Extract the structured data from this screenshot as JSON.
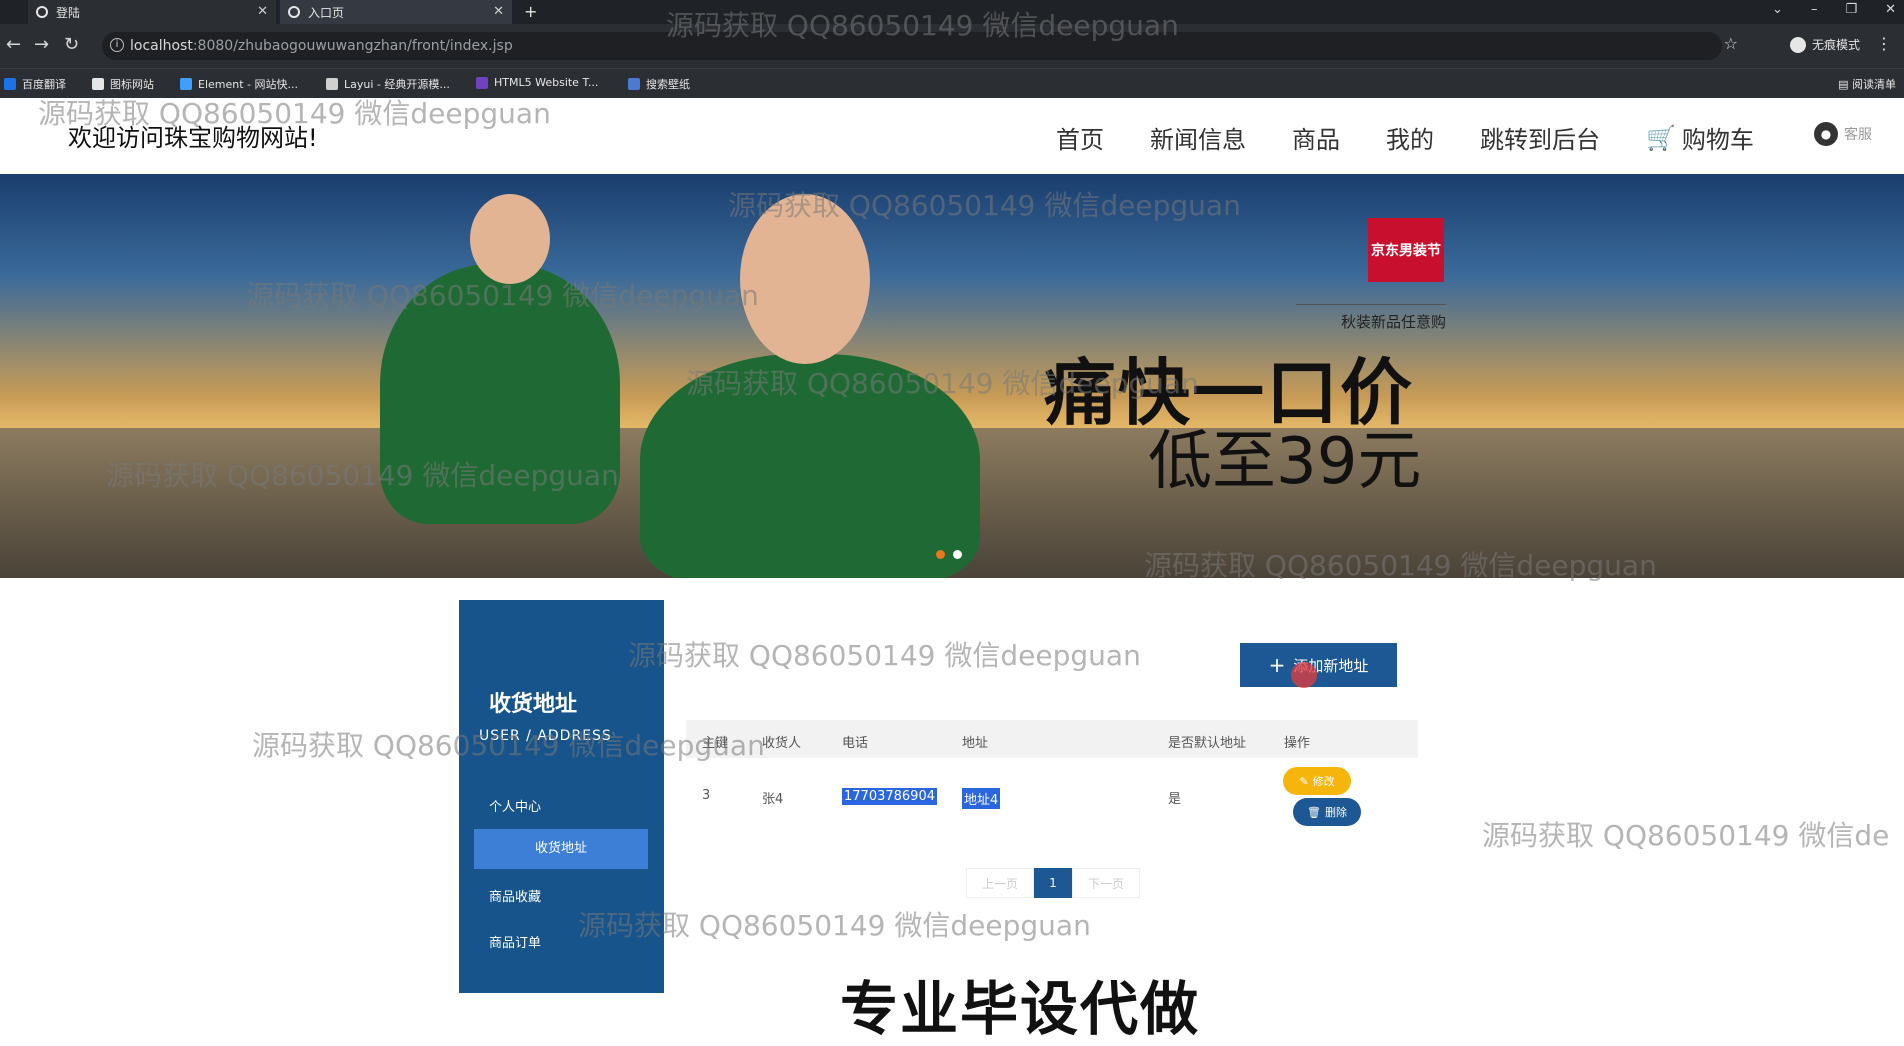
{
  "browser": {
    "tabs": [
      {
        "label": "登陆"
      },
      {
        "label": "入口页"
      }
    ],
    "address_host": "localhost",
    "address_path": ":8080/zhubaogouwuwangzhan/front/index.jsp",
    "incognito_label": "无痕模式",
    "bookmarks": [
      "百度翻译",
      "图标网站",
      "Element - 网站快...",
      "Layui - 经典开源模...",
      "HTML5 Website T...",
      "搜索壁纸"
    ],
    "reading_list": "阅读清单"
  },
  "site": {
    "welcome": "欢迎访问珠宝购物网站!",
    "nav": [
      "首页",
      "新闻信息",
      "商品",
      "我的",
      "跳转到后台",
      "购物车"
    ],
    "kefu": "客服"
  },
  "banner": {
    "brand": "京东男装节",
    "subtitle": "秋装新品任意购",
    "headline": "痛快一口价",
    "price": "低至39元",
    "dot_colors": [
      "#e8771f",
      "#ffffff"
    ]
  },
  "sidebar": {
    "title": "收货地址",
    "subtitle": "USER / ADDRESS",
    "items": [
      "个人中心",
      "收货地址",
      "商品收藏",
      "商品订单"
    ]
  },
  "address": {
    "add_button": "添加新地址",
    "columns": [
      "主键",
      "收货人",
      "电话",
      "地址",
      "是否默认地址",
      "操作"
    ],
    "rows": [
      {
        "id": "3",
        "name": "张4",
        "phone": "17703786904",
        "addr": "地址4",
        "default": "是"
      }
    ],
    "edit_label": "修改",
    "delete_label": "删除",
    "pager": {
      "prev": "上一页",
      "current": "1",
      "next": "下一页"
    }
  },
  "overlay": {
    "watermark": "源码获取 QQ86050149 微信deepguan",
    "watermark_cut": "源码获取 QQ86050149 微信de",
    "footer_text": "专业毕设代做"
  },
  "colors": {
    "primary": "#1d5794",
    "sidebar_bg": "#17548b",
    "active_item": "#3d7ed6",
    "edit": "#f5b50a",
    "selection": "#2a66e0"
  }
}
